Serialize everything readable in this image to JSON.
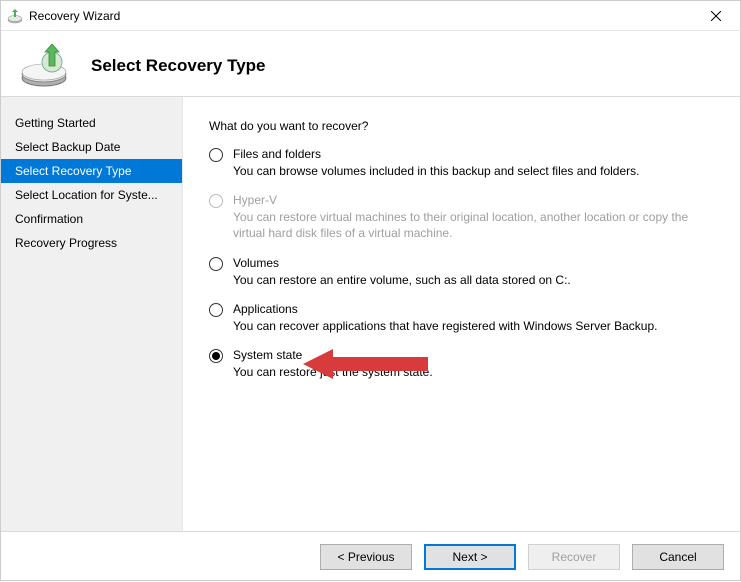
{
  "window": {
    "title": "Recovery Wizard"
  },
  "header": {
    "page_title": "Select Recovery Type"
  },
  "sidebar": {
    "steps": [
      {
        "label": "Getting Started"
      },
      {
        "label": "Select Backup Date"
      },
      {
        "label": "Select Recovery Type"
      },
      {
        "label": "Select Location for Syste..."
      },
      {
        "label": "Confirmation"
      },
      {
        "label": "Recovery Progress"
      }
    ],
    "active_index": 2
  },
  "main": {
    "prompt": "What do you want to recover?",
    "options": [
      {
        "label": "Files and folders",
        "desc": "You can browse volumes included in this backup and select files and folders.",
        "disabled": false,
        "selected": false
      },
      {
        "label": "Hyper-V",
        "desc": "You can restore virtual machines to their original location, another location or copy the virtual hard disk files of a virtual machine.",
        "disabled": true,
        "selected": false
      },
      {
        "label": "Volumes",
        "desc": "You can restore an entire volume, such as all data stored on C:.",
        "disabled": false,
        "selected": false
      },
      {
        "label": "Applications",
        "desc": "You can recover applications that have registered with Windows Server Backup.",
        "disabled": false,
        "selected": false
      },
      {
        "label": "System state",
        "desc": "You can restore just the system state.",
        "disabled": false,
        "selected": true
      }
    ]
  },
  "footer": {
    "previous": "< Previous",
    "next": "Next >",
    "recover": "Recover",
    "cancel": "Cancel"
  }
}
